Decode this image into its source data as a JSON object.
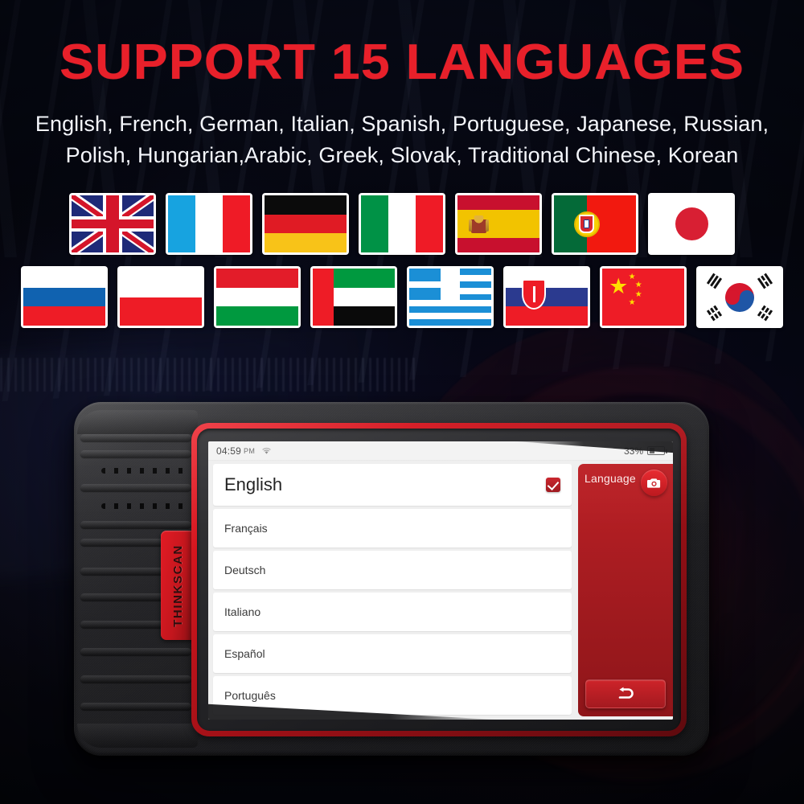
{
  "header": {
    "title": "SUPPORT 15 LANGUAGES",
    "subtitle_line1": "English, French, German, Italian, Spanish, Portuguese, Japanese, Russian,",
    "subtitle_line2": "Polish, Hungarian,Arabic, Greek, Slovak, Traditional Chinese, Korean",
    "title_color": "#e8202a",
    "subtitle_color": "#f4f6fb"
  },
  "flags": {
    "row1": [
      {
        "code": "uk",
        "label": "united-kingdom-flag"
      },
      {
        "code": "fr",
        "label": "france-flag"
      },
      {
        "code": "de",
        "label": "germany-flag"
      },
      {
        "code": "it",
        "label": "italy-flag"
      },
      {
        "code": "es",
        "label": "spain-flag"
      },
      {
        "code": "pt",
        "label": "portugal-flag"
      },
      {
        "code": "jp",
        "label": "japan-flag"
      }
    ],
    "row2": [
      {
        "code": "ru",
        "label": "russia-flag"
      },
      {
        "code": "pl",
        "label": "poland-flag"
      },
      {
        "code": "hu",
        "label": "hungary-flag"
      },
      {
        "code": "ae",
        "label": "uae-arabic-flag"
      },
      {
        "code": "gr",
        "label": "greece-flag"
      },
      {
        "code": "sk",
        "label": "slovakia-flag"
      },
      {
        "code": "cn",
        "label": "china-flag"
      },
      {
        "code": "kr",
        "label": "south-korea-flag"
      }
    ]
  },
  "device": {
    "brand": "THINKSCAN",
    "brand_tab_color": "#d4151e",
    "bezel_color": "#c3161d"
  },
  "screen": {
    "statusbar": {
      "time": "04:59",
      "ampm": "PM",
      "wifi_icon": "wifi-icon",
      "battery_percent": "33%",
      "battery_icon": "battery-icon"
    },
    "language_list": [
      {
        "name": "English",
        "selected": true
      },
      {
        "name": "Français",
        "selected": false
      },
      {
        "name": "Deutsch",
        "selected": false
      },
      {
        "name": "Italiano",
        "selected": false
      },
      {
        "name": "Español",
        "selected": false
      },
      {
        "name": "Português",
        "selected": false
      }
    ],
    "side_panel": {
      "title": "Language",
      "camera_icon": "camera-icon",
      "back_icon": "back-arrow-icon",
      "panel_color": "#a81c21"
    }
  }
}
